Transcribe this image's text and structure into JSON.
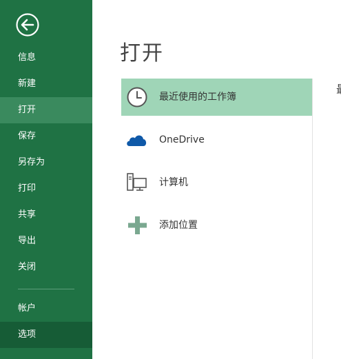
{
  "nav": {
    "items": [
      {
        "label": "信息"
      },
      {
        "label": "新建"
      },
      {
        "label": "打开"
      },
      {
        "label": "保存"
      },
      {
        "label": "另存为"
      },
      {
        "label": "打印"
      },
      {
        "label": "共享"
      },
      {
        "label": "导出"
      },
      {
        "label": "关闭"
      },
      {
        "label": "帐户"
      },
      {
        "label": "选项"
      }
    ],
    "active_index": 2
  },
  "main": {
    "title": "打开",
    "locations": [
      {
        "label": "最近使用的工作簿",
        "icon": "clock-icon",
        "selected": true
      },
      {
        "label": "OneDrive",
        "icon": "onedrive-cloud-icon",
        "selected": false
      },
      {
        "label": "计算机",
        "icon": "computer-icon",
        "selected": false
      },
      {
        "label": "添加位置",
        "icon": "plus-icon",
        "selected": false
      }
    ],
    "right_heading": "最"
  },
  "colors": {
    "nav_bg": "#1f7244",
    "nav_active": "#3a8a5e",
    "nav_options": "#165c36",
    "selected_location": "#9fd5b7",
    "onedrive_blue": "#0f59a8",
    "plus_green": "#7aa890"
  }
}
